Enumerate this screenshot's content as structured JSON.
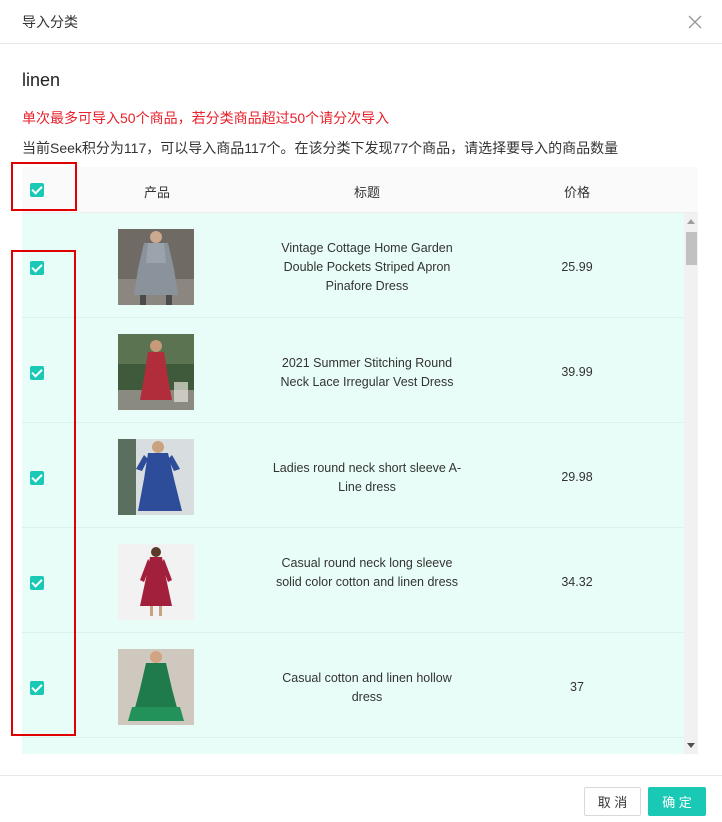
{
  "modal": {
    "title": "导入分类",
    "close_icon": "close-icon"
  },
  "category": {
    "name": "linen"
  },
  "messages": {
    "warning": "单次最多可导入50个商品，若分类商品超过50个请分次导入",
    "info": "当前Seek积分为117，可以导入商品117个。在该分类下发现77个商品，请选择要导入的商品数量"
  },
  "table": {
    "headers": {
      "product": "产品",
      "title": "标题",
      "price": "价格"
    },
    "select_all_checked": true,
    "rows": [
      {
        "checked": true,
        "image": "grey-linen-pinafore-dress-photo",
        "title": "Vintage Cottage Home Garden Double Pockets Striped Apron Pinafore Dress",
        "price": "25.99"
      },
      {
        "checked": true,
        "image": "red-summer-dress-photo",
        "title": "2021 Summer Stitching Round Neck Lace Irregular Vest Dress",
        "price": "39.99"
      },
      {
        "checked": true,
        "image": "blue-aline-dress-photo",
        "title": "Ladies round neck short sleeve A-Line dress",
        "price": "29.98"
      },
      {
        "checked": true,
        "image": "wine-red-long-sleeve-dress-photo",
        "title": "Casual round neck long sleeve solid color cotton and linen dress",
        "price": "34.32"
      },
      {
        "checked": true,
        "image": "green-hollow-dress-photo",
        "title": "Casual cotton and linen hollow dress",
        "price": "37"
      }
    ]
  },
  "footer": {
    "cancel_label": "取 消",
    "ok_label": "确 定"
  },
  "colors": {
    "accent": "#19c8b5",
    "warning": "#e8212b",
    "row_bg": "#e8fdf7",
    "highlight_box": "#e00000"
  }
}
